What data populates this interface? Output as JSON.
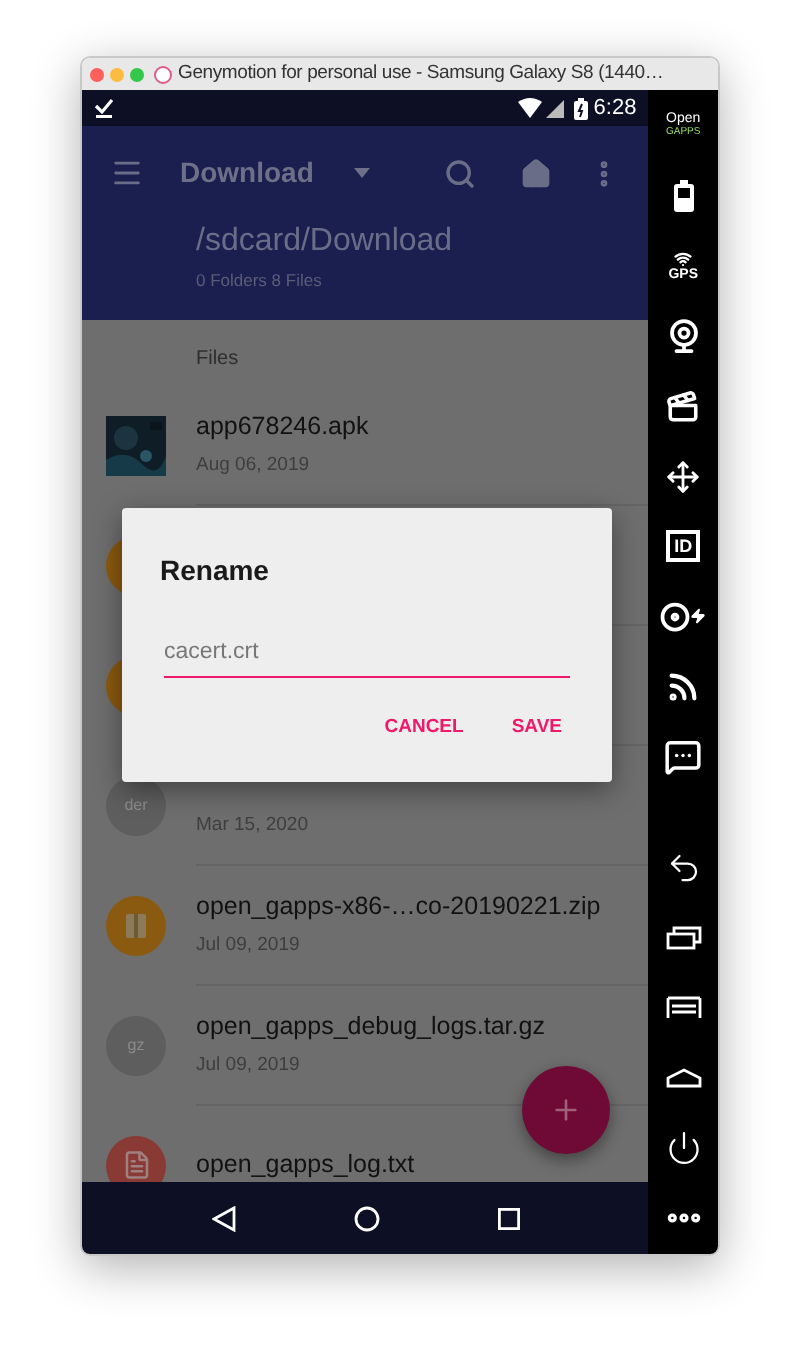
{
  "window": {
    "title": "Genymotion for personal use - Samsung Galaxy S8 (1440…"
  },
  "status_bar": {
    "time": "6:28"
  },
  "app_bar": {
    "title": "Download"
  },
  "path_header": {
    "path": "/sdcard/Download",
    "summary": "0 Folders 8 Files"
  },
  "section_label": "Files",
  "files": [
    {
      "kind": "thumbnail",
      "name": "app678246.apk",
      "date": "Aug 06, 2019"
    },
    {
      "kind": "circle",
      "color": "#8a5a10"
    },
    {
      "kind": "circle",
      "color": "#8a5a10"
    },
    {
      "kind": "text-badge",
      "color": "#5e5e5e",
      "badge": "der",
      "date": "Mar 15, 2020"
    },
    {
      "kind": "archive",
      "color": "#8a5a10",
      "name": "open_gapps-x86-…co-20190221.zip",
      "date": "Jul 09, 2019"
    },
    {
      "kind": "text-badge",
      "color": "#5e5e5e",
      "badge": "gz",
      "name": "open_gapps_debug_logs.tar.gz",
      "date": "Jul 09, 2019"
    },
    {
      "kind": "document",
      "color": "#8a3a35",
      "name": "open_gapps_log.txt"
    }
  ],
  "dialog": {
    "title": "Rename",
    "value": "cacert.crt",
    "buttons": [
      "CANCEL",
      "SAVE"
    ]
  },
  "sidebar": {
    "tools": [
      {
        "kind": "opengapps",
        "lines": [
          "Open",
          "GAPPS"
        ]
      },
      {
        "kind": "battery"
      },
      {
        "kind": "gps",
        "label": "GPS"
      },
      {
        "kind": "webcam"
      },
      {
        "kind": "clapper"
      },
      {
        "kind": "move"
      },
      {
        "kind": "id",
        "label": "ID"
      },
      {
        "kind": "disc"
      },
      {
        "kind": "rss"
      },
      {
        "kind": "message"
      }
    ],
    "device_buttons": [
      {
        "kind": "back"
      },
      {
        "kind": "recent"
      },
      {
        "kind": "menu"
      },
      {
        "kind": "home"
      },
      {
        "kind": "power"
      },
      {
        "kind": "more"
      }
    ]
  }
}
